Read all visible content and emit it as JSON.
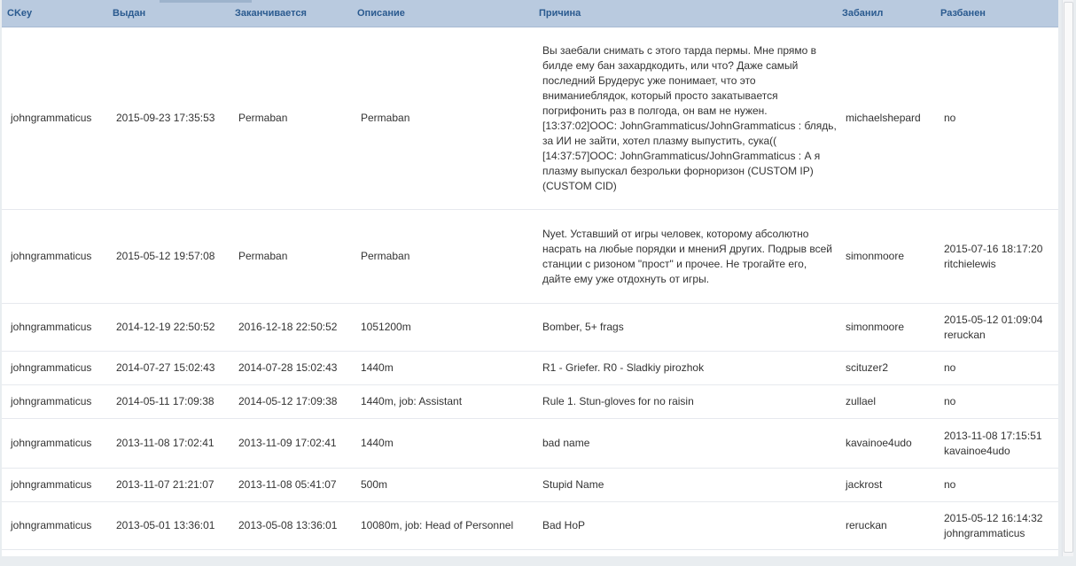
{
  "columns": {
    "ckey": "CKey",
    "issued": "Выдан",
    "expires": "Заканчивается",
    "description": "Описание",
    "reason": "Причина",
    "banned_by": "Забанил",
    "unbanned": "Разбанен"
  },
  "rows": [
    {
      "ckey": "johngrammaticus",
      "issued": "2015-09-23 17:35:53",
      "expires": "Permaban",
      "description": "Permaban",
      "reason": "Вы заебали снимать с этого тарда пермы. Мне прямо в билде ему бан захардкодить, или что? Даже самый последний Брудерус уже понимает, что это вниманиеблядок, который просто закатывается погрифонить раз в полгода, он вам не нужен. [13:37:02]OOC: JohnGrammaticus/JohnGrammaticus : блядь, за ИИ не зайти, хотел плазму выпустить, сука(( [14:37:57]OOC: JohnGrammaticus/JohnGrammaticus : А я плазму выпускал безрольки форноризон (CUSTOM IP) (CUSTOM CID)",
      "banned_by": "michaelshepard",
      "unban_date": "no",
      "unban_by": ""
    },
    {
      "ckey": "johngrammaticus",
      "issued": "2015-05-12 19:57:08",
      "expires": "Permaban",
      "description": "Permaban",
      "reason": "Nyet. Уставший от игры человек, которому абсолютно насрать на любые порядки и мнениЯ других. Подрыв всей станции с ризоном \"прост\" и прочее. Не трогайте его, дайте ему уже отдохнуть от игры.",
      "banned_by": "simonmoore",
      "unban_date": "2015-07-16 18:17:20",
      "unban_by": "ritchielewis"
    },
    {
      "ckey": "johngrammaticus",
      "issued": "2014-12-19 22:50:52",
      "expires": "2016-12-18 22:50:52",
      "description": "1051200m",
      "reason": "Bomber, 5+ frags",
      "banned_by": "simonmoore",
      "unban_date": "2015-05-12 01:09:04",
      "unban_by": "reruckan"
    },
    {
      "ckey": "johngrammaticus",
      "issued": "2014-07-27 15:02:43",
      "expires": "2014-07-28 15:02:43",
      "description": "1440m",
      "reason": "R1 - Griefer. R0 - Sladkiy pirozhok",
      "banned_by": "scituzer2",
      "unban_date": "no",
      "unban_by": ""
    },
    {
      "ckey": "johngrammaticus",
      "issued": "2014-05-11 17:09:38",
      "expires": "2014-05-12 17:09:38",
      "description": "1440m, job: Assistant",
      "reason": "Rule 1. Stun-gloves for no raisin",
      "banned_by": "zullael",
      "unban_date": "no",
      "unban_by": ""
    },
    {
      "ckey": "johngrammaticus",
      "issued": "2013-11-08 17:02:41",
      "expires": "2013-11-09 17:02:41",
      "description": "1440m",
      "reason": "bad name",
      "banned_by": "kavainoe4udo",
      "unban_date": "2013-11-08 17:15:51",
      "unban_by": "kavainoe4udo"
    },
    {
      "ckey": "johngrammaticus",
      "issued": "2013-11-07 21:21:07",
      "expires": "2013-11-08 05:41:07",
      "description": "500m",
      "reason": "Stupid Name",
      "banned_by": "jackrost",
      "unban_date": "no",
      "unban_by": ""
    },
    {
      "ckey": "johngrammaticus",
      "issued": "2013-05-01 13:36:01",
      "expires": "2013-05-08 13:36:01",
      "description": "10080m, job: Head of Personnel",
      "reason": "Bad HoP",
      "banned_by": "reruckan",
      "unban_date": "2015-05-12 16:14:32",
      "unban_by": "johngrammaticus"
    }
  ]
}
